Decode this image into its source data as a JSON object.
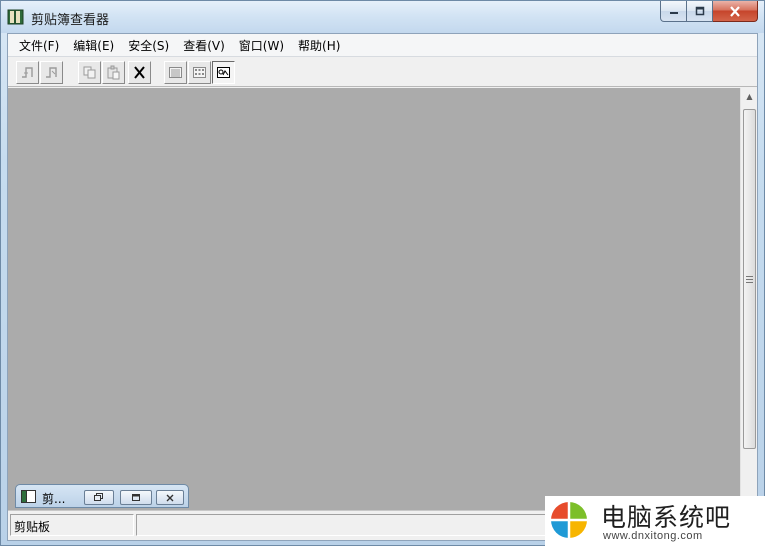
{
  "window": {
    "title": "剪贴簿查看器",
    "icon": "book-icon"
  },
  "menu": {
    "items": [
      {
        "label": "文件(F)"
      },
      {
        "label": "编辑(E)"
      },
      {
        "label": "安全(S)"
      },
      {
        "label": "查看(V)"
      },
      {
        "label": "窗口(W)"
      },
      {
        "label": "帮助(H)"
      }
    ]
  },
  "toolbar": {
    "buttons": [
      {
        "name": "connect-icon"
      },
      {
        "name": "disconnect-icon"
      },
      {
        "name": "copy-icon"
      },
      {
        "name": "paste-icon"
      },
      {
        "name": "delete-icon"
      },
      {
        "name": "list-view-icon"
      },
      {
        "name": "page-view-icon"
      },
      {
        "name": "full-content-icon"
      }
    ]
  },
  "child_window": {
    "title": "剪..."
  },
  "statusbar": {
    "pane1": "剪贴板"
  },
  "watermark": {
    "brand": "电脑系统吧",
    "url": "www.dnxitong.com"
  },
  "colors": {
    "workspace": "#ababab",
    "close_button": "#c6452c"
  }
}
